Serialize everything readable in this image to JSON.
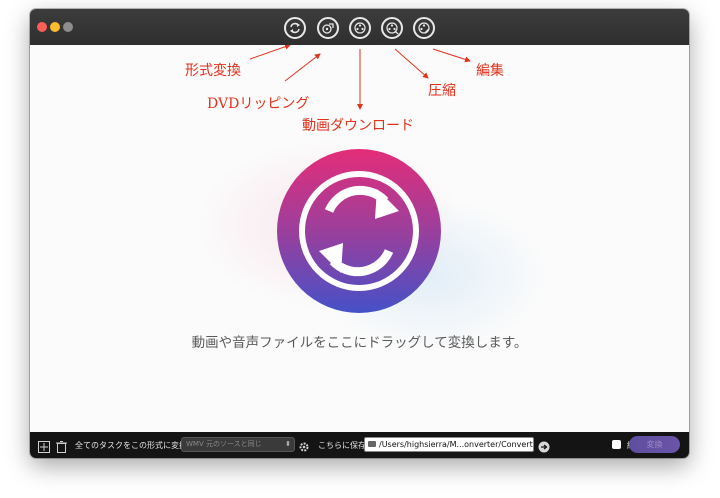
{
  "toolbar": {
    "buttons": [
      {
        "icon": "convert-icon"
      },
      {
        "icon": "dvd-rip-icon"
      },
      {
        "icon": "film-download-icon"
      },
      {
        "icon": "film-compress-icon"
      },
      {
        "icon": "film-edit-icon"
      }
    ]
  },
  "annotations": {
    "convert": "形式変換",
    "dvd_rip": "DVDリッピング",
    "download": "動画ダウンロード",
    "compress": "圧縮",
    "edit": "編集"
  },
  "main": {
    "drop_text": "動画や音声ファイルをここにドラッグして変換します。",
    "gradient_colors": [
      "#e42d78",
      "#9b3f9c",
      "#4551c8"
    ]
  },
  "bottom": {
    "format_label": "全てのタスクをこの形式に変換",
    "format_value": "WMV 元のソースと同じ",
    "save_label": "こちらに保存",
    "save_path": "/Users/highsierra/M...onverter/Converted",
    "merge_label": "結合",
    "convert_label": "変換"
  },
  "colors": {
    "annotation": "#e0321c",
    "titlebar": "#363636",
    "bottombar": "#141414"
  }
}
